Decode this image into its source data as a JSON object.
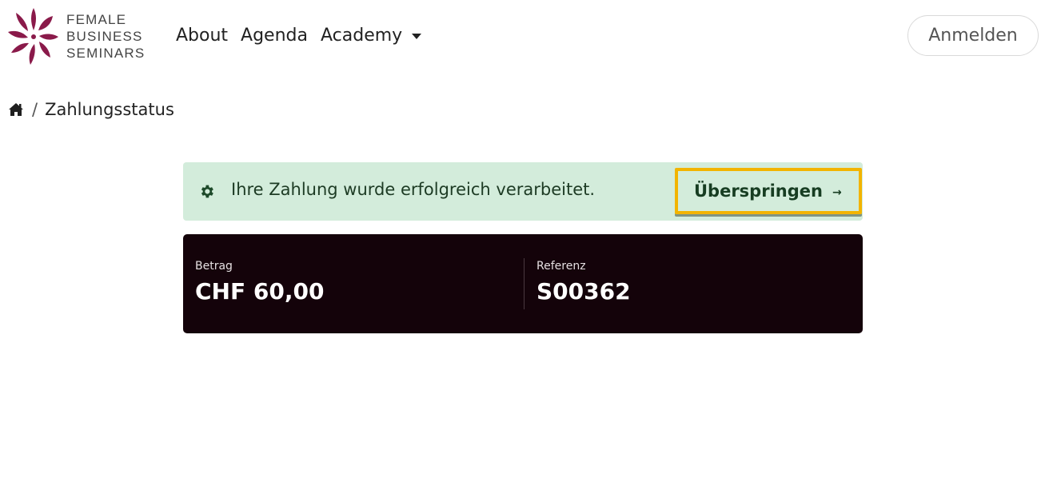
{
  "brand": {
    "logo_lines": [
      "FEMALE",
      "BUSINESS",
      "SEMINARS"
    ],
    "logo_color": "#8a1a4a"
  },
  "nav": {
    "items": [
      {
        "label": "About"
      },
      {
        "label": "Agenda"
      },
      {
        "label": "Academy"
      }
    ],
    "login_label": "Anmelden"
  },
  "breadcrumb": {
    "home_icon": "home-icon",
    "separator": "/",
    "current": "Zahlungsstatus"
  },
  "alert": {
    "icon": "gear-icon",
    "message": "Ihre Zahlung wurde erfolgreich verarbeitet.",
    "skip_label": "Überspringen",
    "skip_arrow": "→",
    "background": "#d3ecdb",
    "highlight_color": "#f2b400"
  },
  "payment": {
    "amount_label": "Betrag",
    "amount_value": "CHF 60,00",
    "reference_label": "Referenz",
    "reference_value": "S00362",
    "card_background": "#14030a"
  }
}
